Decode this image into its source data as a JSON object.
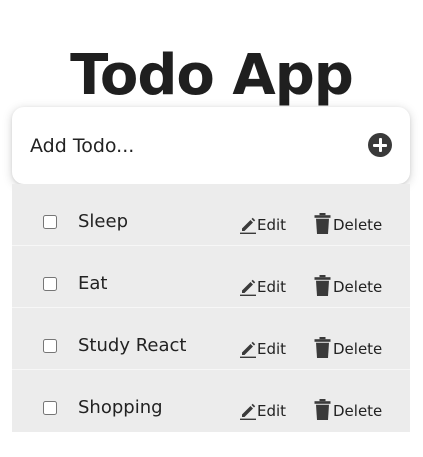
{
  "app": {
    "title": "Todo App"
  },
  "add_todo": {
    "placeholder": "Add Todo...",
    "button_icon": "plus-circle-icon"
  },
  "colors": {
    "list_background": "#ececec",
    "icon": "#3a3a3a"
  },
  "todos": [
    {
      "label": "Sleep",
      "checked": false,
      "edit_label": "Edit",
      "delete_label": "Delete"
    },
    {
      "label": "Eat",
      "checked": false,
      "edit_label": "Edit",
      "delete_label": "Delete"
    },
    {
      "label": "Study React",
      "checked": false,
      "edit_label": "Edit",
      "delete_label": "Delete"
    },
    {
      "label": "Shopping",
      "checked": false,
      "edit_label": "Edit",
      "delete_label": "Delete"
    }
  ]
}
